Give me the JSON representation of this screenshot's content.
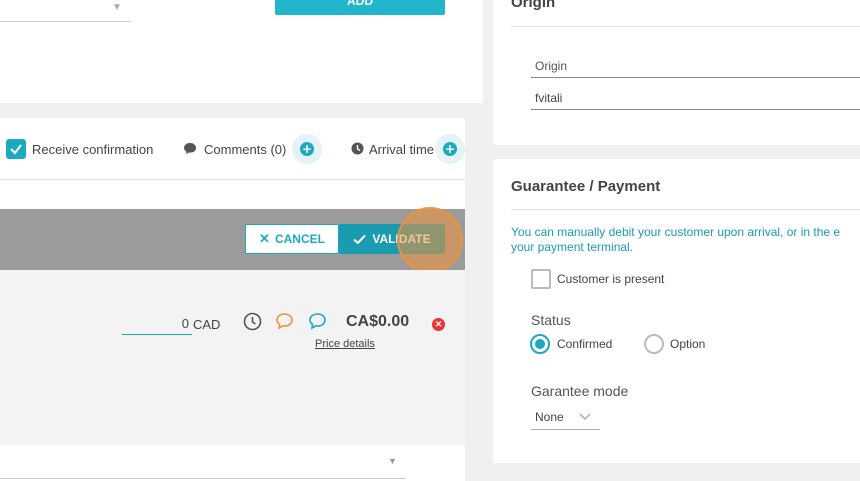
{
  "top_form": {
    "add_label": "ADD"
  },
  "options_bar": {
    "receive_confirmation": "Receive confirmation",
    "comments": "Comments (0)",
    "arrival_time": "Arrival time"
  },
  "action_bar": {
    "cancel_label": "CANCEL",
    "validate_label": "VALIDATE"
  },
  "price_row": {
    "amount_value": "0",
    "currency": "CAD",
    "total": "CA$0.00",
    "price_details": "Price details"
  },
  "origin": {
    "title": "Origin",
    "field_label": "Origin",
    "field_value": "fvitali"
  },
  "guarantee": {
    "title": "Guarantee / Payment",
    "info_line1": "You can manually debit your customer upon arrival, or in the e",
    "info_line2": "your payment terminal.",
    "customer_present": "Customer is present",
    "status_label": "Status",
    "status_confirmed": "Confirmed",
    "status_option": "Option",
    "mode_label": "Garantee mode",
    "mode_value": "None"
  },
  "colors": {
    "accent": "#1ea9bf",
    "cursor": "#f0923a"
  }
}
